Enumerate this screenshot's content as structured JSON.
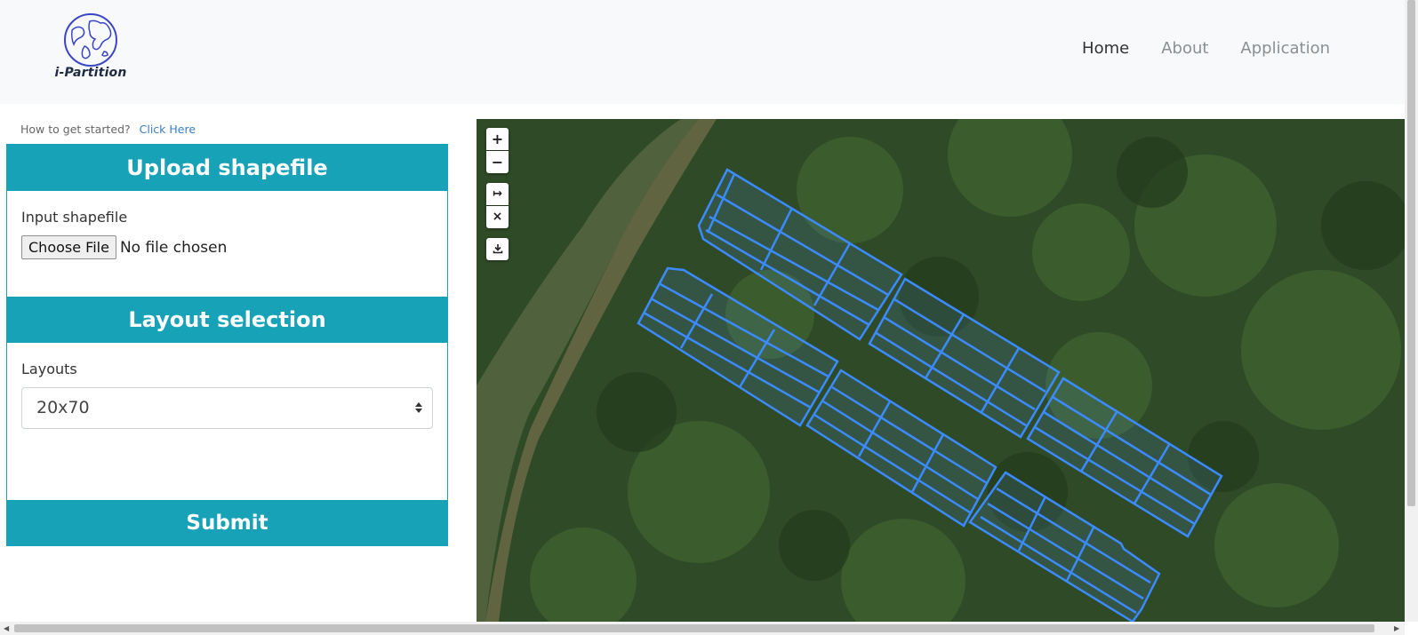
{
  "brand": {
    "name": "i-Partition",
    "icon": "globe-icon"
  },
  "nav": {
    "items": [
      {
        "label": "Home",
        "active": true
      },
      {
        "label": "About"
      },
      {
        "label": "Application"
      }
    ]
  },
  "help": {
    "prefix": "How to get started?",
    "link": "Click Here"
  },
  "upload": {
    "title": "Upload shapefile",
    "field_label": "Input shapefile",
    "button": "Choose File",
    "status": "No file chosen"
  },
  "layout": {
    "title": "Layout selection",
    "field_label": "Layouts",
    "selected": "20x70"
  },
  "submit_label": "Submit",
  "map": {
    "controls": {
      "zoom_in": "+",
      "zoom_out": "−",
      "measure": "↦",
      "clear": "×",
      "download_icon": "download-icon"
    },
    "partition_color": "#3b8bff"
  },
  "colors": {
    "accent": "#17a2b8",
    "navbar_bg": "#f8f9fa"
  }
}
